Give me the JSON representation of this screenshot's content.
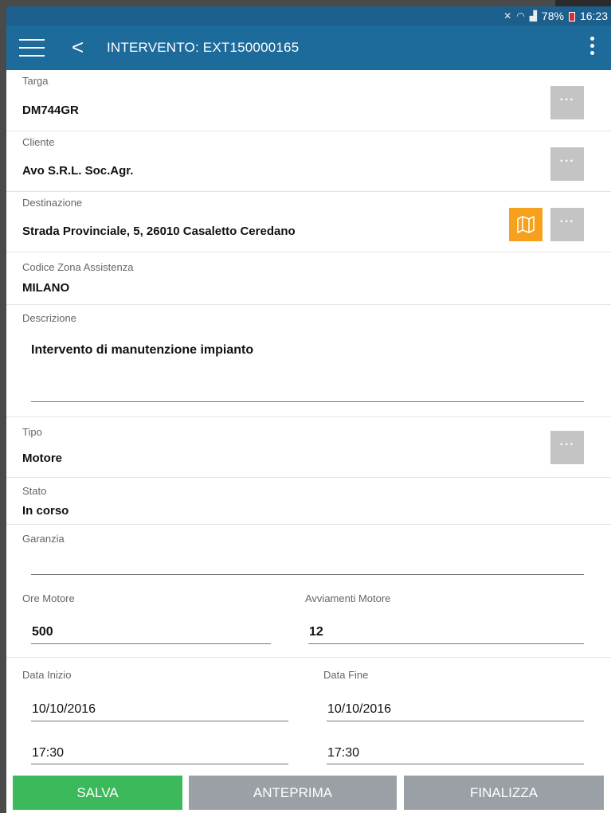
{
  "status_bar": {
    "battery": "78%",
    "time": "16:23"
  },
  "app_bar": {
    "title": "INTERVENTO: EXT150000165"
  },
  "fields": {
    "targa": {
      "label": "Targa",
      "value": "DM744GR"
    },
    "cliente": {
      "label": "Cliente",
      "value": "Avo S.R.L. Soc.Agr."
    },
    "destinazione": {
      "label": "Destinazione",
      "value": "Strada Provinciale, 5, 26010 Casaletto Ceredano"
    },
    "zona": {
      "label": "Codice Zona Assistenza",
      "value": "MILANO"
    },
    "descrizione": {
      "label": "Descrizione",
      "value": "Intervento di manutenzione impianto"
    },
    "tipo": {
      "label": "Tipo",
      "value": "Motore"
    },
    "stato": {
      "label": "Stato",
      "value": "In corso"
    },
    "garanzia": {
      "label": "Garanzia",
      "value": ""
    },
    "ore_motore": {
      "label": "Ore Motore",
      "value": "500"
    },
    "avviamenti": {
      "label": "Avviamenti Motore",
      "value": "12"
    },
    "data_inizio": {
      "label": "Data Inizio",
      "date": "10/10/2016",
      "time": "17:30"
    },
    "data_fine": {
      "label": "Data Fine",
      "date": "10/10/2016",
      "time": "17:30"
    }
  },
  "buttons": {
    "dots": "···",
    "salva": "SALVA",
    "anteprima": "ANTEPRIMA",
    "finalizza": "FINALIZZA"
  },
  "colors": {
    "app_bar": "#1d6b9b",
    "salva": "#3cb95a",
    "secondary": "#9aa0a6",
    "map_button": "#f7a01b"
  }
}
